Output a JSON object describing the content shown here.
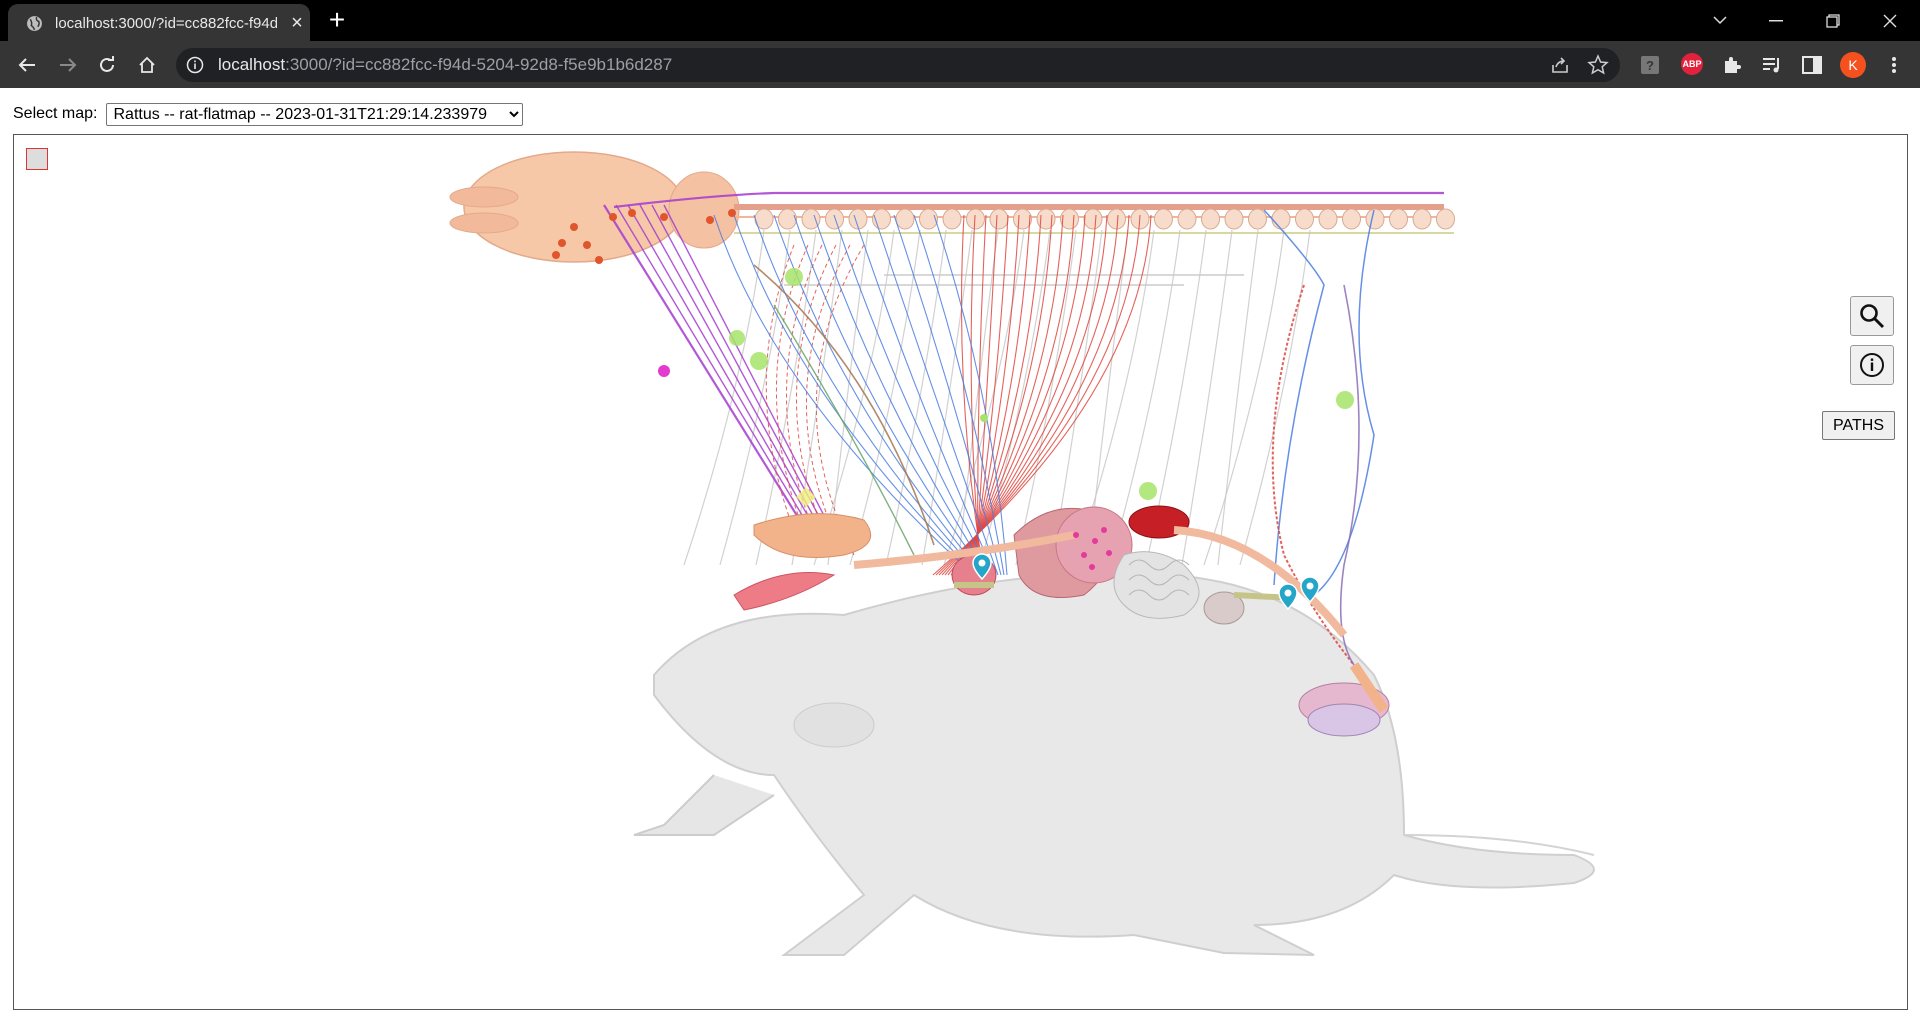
{
  "browser": {
    "tab": {
      "title": "localhost:3000/?id=cc882fcc-f94d"
    },
    "address": {
      "host": "localhost",
      "rest": ":3000/?id=cc882fcc-f94d-5204-92d8-f5e9b1b6d287"
    },
    "profile_initial": "K",
    "abp_label": "ABP"
  },
  "page": {
    "select_label": "Select map:",
    "selected_map": "Rattus -- rat-flatmap -- 2023-01-31T21:29:14.233979",
    "paths_button": "PATHS"
  },
  "colors": {
    "nerve_purple": "#a43bd0",
    "nerve_blue": "#4a7de0",
    "nerve_red": "#e0473f",
    "organ_green": "#a6e36a",
    "marker_teal": "#25a6c8",
    "body_gray": "#e7e7e7"
  },
  "icons": [
    "globe-icon",
    "close-icon",
    "plus-icon",
    "back-icon",
    "forward-icon",
    "reload-icon",
    "home-icon",
    "info-icon",
    "share-icon",
    "star-icon",
    "search-icon",
    "info-circle-icon"
  ]
}
